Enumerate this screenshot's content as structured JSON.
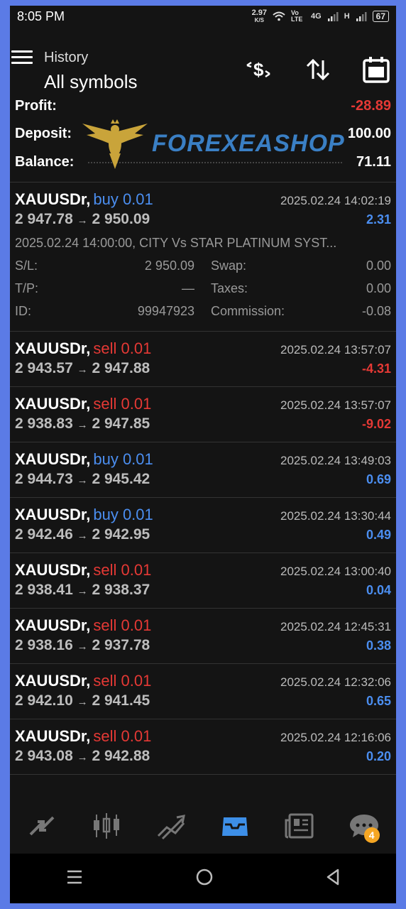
{
  "status_bar": {
    "time": "8:05 PM",
    "net_speed": "2.97",
    "net_unit": "K/S",
    "volte": "Vo LTE",
    "network": "4G",
    "signal2": "H",
    "battery": "67"
  },
  "header": {
    "subtitle": "History",
    "title": "All symbols"
  },
  "summary": {
    "profit_label": "Profit:",
    "profit_value": "-28.89",
    "deposit_label": "Deposit:",
    "deposit_value": "100.00",
    "balance_label": "Balance:",
    "balance_value": "71.11"
  },
  "watermark": "FOREXEASHOP",
  "expanded_trade": {
    "symbol": "XAUUSDr,",
    "side": "buy 0.01",
    "time": "2025.02.24 14:02:19",
    "open": "2 947.78",
    "arrow": "→",
    "close": "2 950.09",
    "profit": "2.31",
    "comment": "2025.02.24 14:00:00, CITY Vs STAR PLATINUM SYST...",
    "sl_label": "S/L:",
    "sl_value": "2 950.09",
    "tp_label": "T/P:",
    "tp_value": "—",
    "id_label": "ID:",
    "id_value": "99947923",
    "swap_label": "Swap:",
    "swap_value": "0.00",
    "taxes_label": "Taxes:",
    "taxes_value": "0.00",
    "commission_label": "Commission:",
    "commission_value": "-0.08"
  },
  "trades": [
    {
      "symbol": "XAUUSDr,",
      "side": "sell 0.01",
      "side_type": "sell",
      "time": "2025.02.24 13:57:07",
      "open": "2 943.57",
      "close": "2 947.88",
      "profit": "-4.31",
      "profit_type": "loss"
    },
    {
      "symbol": "XAUUSDr,",
      "side": "sell 0.01",
      "side_type": "sell",
      "time": "2025.02.24 13:57:07",
      "open": "2 938.83",
      "close": "2 947.85",
      "profit": "-9.02",
      "profit_type": "loss"
    },
    {
      "symbol": "XAUUSDr,",
      "side": "buy 0.01",
      "side_type": "buy",
      "time": "2025.02.24 13:49:03",
      "open": "2 944.73",
      "close": "2 945.42",
      "profit": "0.69",
      "profit_type": "gain"
    },
    {
      "symbol": "XAUUSDr,",
      "side": "buy 0.01",
      "side_type": "buy",
      "time": "2025.02.24 13:30:44",
      "open": "2 942.46",
      "close": "2 942.95",
      "profit": "0.49",
      "profit_type": "gain"
    },
    {
      "symbol": "XAUUSDr,",
      "side": "sell 0.01",
      "side_type": "sell",
      "time": "2025.02.24 13:00:40",
      "open": "2 938.41",
      "close": "2 938.37",
      "profit": "0.04",
      "profit_type": "gain"
    },
    {
      "symbol": "XAUUSDr,",
      "side": "sell 0.01",
      "side_type": "sell",
      "time": "2025.02.24 12:45:31",
      "open": "2 938.16",
      "close": "2 937.78",
      "profit": "0.38",
      "profit_type": "gain"
    },
    {
      "symbol": "XAUUSDr,",
      "side": "sell 0.01",
      "side_type": "sell",
      "time": "2025.02.24 12:32:06",
      "open": "2 942.10",
      "close": "2 941.45",
      "profit": "0.65",
      "profit_type": "gain"
    },
    {
      "symbol": "XAUUSDr,",
      "side": "sell 0.01",
      "side_type": "sell",
      "time": "2025.02.24 12:16:06",
      "open": "2 943.08",
      "close": "2 942.88",
      "profit": "0.20",
      "profit_type": "gain"
    }
  ],
  "bottom_nav": {
    "items": [
      "quotes-icon",
      "chart-icon",
      "trade-icon",
      "history-icon",
      "news-icon",
      "messages-icon"
    ],
    "active": "history-icon",
    "messages_badge": "4"
  },
  "colors": {
    "buy": "#4b8ef0",
    "sell": "#e53935",
    "gain": "#4b8ef0",
    "loss": "#e53935",
    "active_nav": "#3d8fe8"
  }
}
